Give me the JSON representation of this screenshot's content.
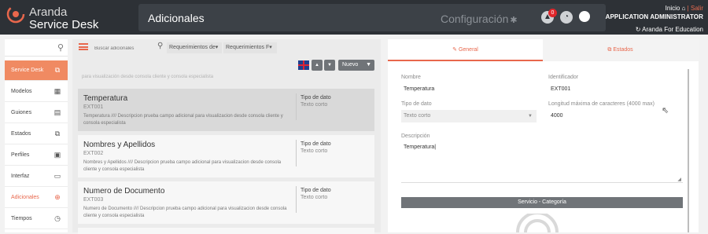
{
  "app": {
    "logo_line1": "Aranda",
    "logo_line2": "Service Desk",
    "page_title": "Adicionales",
    "config_label": "Configuración",
    "notification_count": "0",
    "user": {
      "inicio": "Inicio",
      "separator": "|",
      "salir": "Salir",
      "role": "APPLICATION ADMINISTRATOR",
      "project": "Aranda For Education"
    }
  },
  "sidebar": {
    "items": [
      {
        "label": "Service Desk",
        "icon": "stack-icon",
        "glyph": "⧉"
      },
      {
        "label": "Modelos",
        "icon": "grid-icon",
        "glyph": "▦"
      },
      {
        "label": "Guiones",
        "icon": "document-icon",
        "glyph": "▤"
      },
      {
        "label": "Estados",
        "icon": "copy-icon",
        "glyph": "⧉"
      },
      {
        "label": "Perfiles",
        "icon": "id-card-icon",
        "glyph": "▣"
      },
      {
        "label": "Interfaz",
        "icon": "monitor-icon",
        "glyph": "▭"
      },
      {
        "label": "Adicionales",
        "icon": "plus-circle-icon",
        "glyph": "⊕"
      },
      {
        "label": "Tiempos",
        "icon": "clock-icon",
        "glyph": "◷"
      }
    ]
  },
  "list": {
    "search_placeholder": "Buscar adicionales",
    "filter1": "Requerimientos de▾",
    "filter2": "Requerimientos F▾",
    "nuevo_label": "Nuevo",
    "prev_snippet": "para visualización desde consola cliente y consola especialista",
    "items": [
      {
        "name": "Temperatura",
        "code": "EXT001",
        "desc": "Temperatura //// Descripcion prueba campo adicional para visualizacion desde consola cliente y consola especialista",
        "type_label": "Tipo de dato",
        "type_value": "Texto corto"
      },
      {
        "name": "Nombres y Apellidos",
        "code": "EXT002",
        "desc": "Nombres y Apellidos //// Descripcion prueba campo adicional para visualizacion desde consola cliente y consola especialista",
        "type_label": "Tipo de dato",
        "type_value": "Texto corto"
      },
      {
        "name": "Numero de Documento",
        "code": "EXT003",
        "desc": "Numero de Documento //// Descripcion prueba campo adicional para visualizacion desde consola cliente y consola especialista",
        "type_label": "Tipo de dato",
        "type_value": "Texto corto"
      }
    ]
  },
  "detail": {
    "tabs": [
      "General",
      "Estados"
    ],
    "nombre_label": "Nombre",
    "nombre_value": "Temperatura",
    "identificador_label": "Identificador",
    "identificador_value": "EXT001",
    "tipo_label": "Tipo de dato",
    "tipo_value": "Texto corto",
    "longitud_label": "Longitud máxima de caracteres (4000 max)",
    "longitud_value": "4000",
    "descripcion_label": "Descripción",
    "descripcion_value": "Temperatura",
    "section_title": "Servicio - Categoría"
  },
  "colors": {
    "accent": "#e8674c",
    "topbar": "#2d3136",
    "active_sidebar": "#f08a62"
  }
}
